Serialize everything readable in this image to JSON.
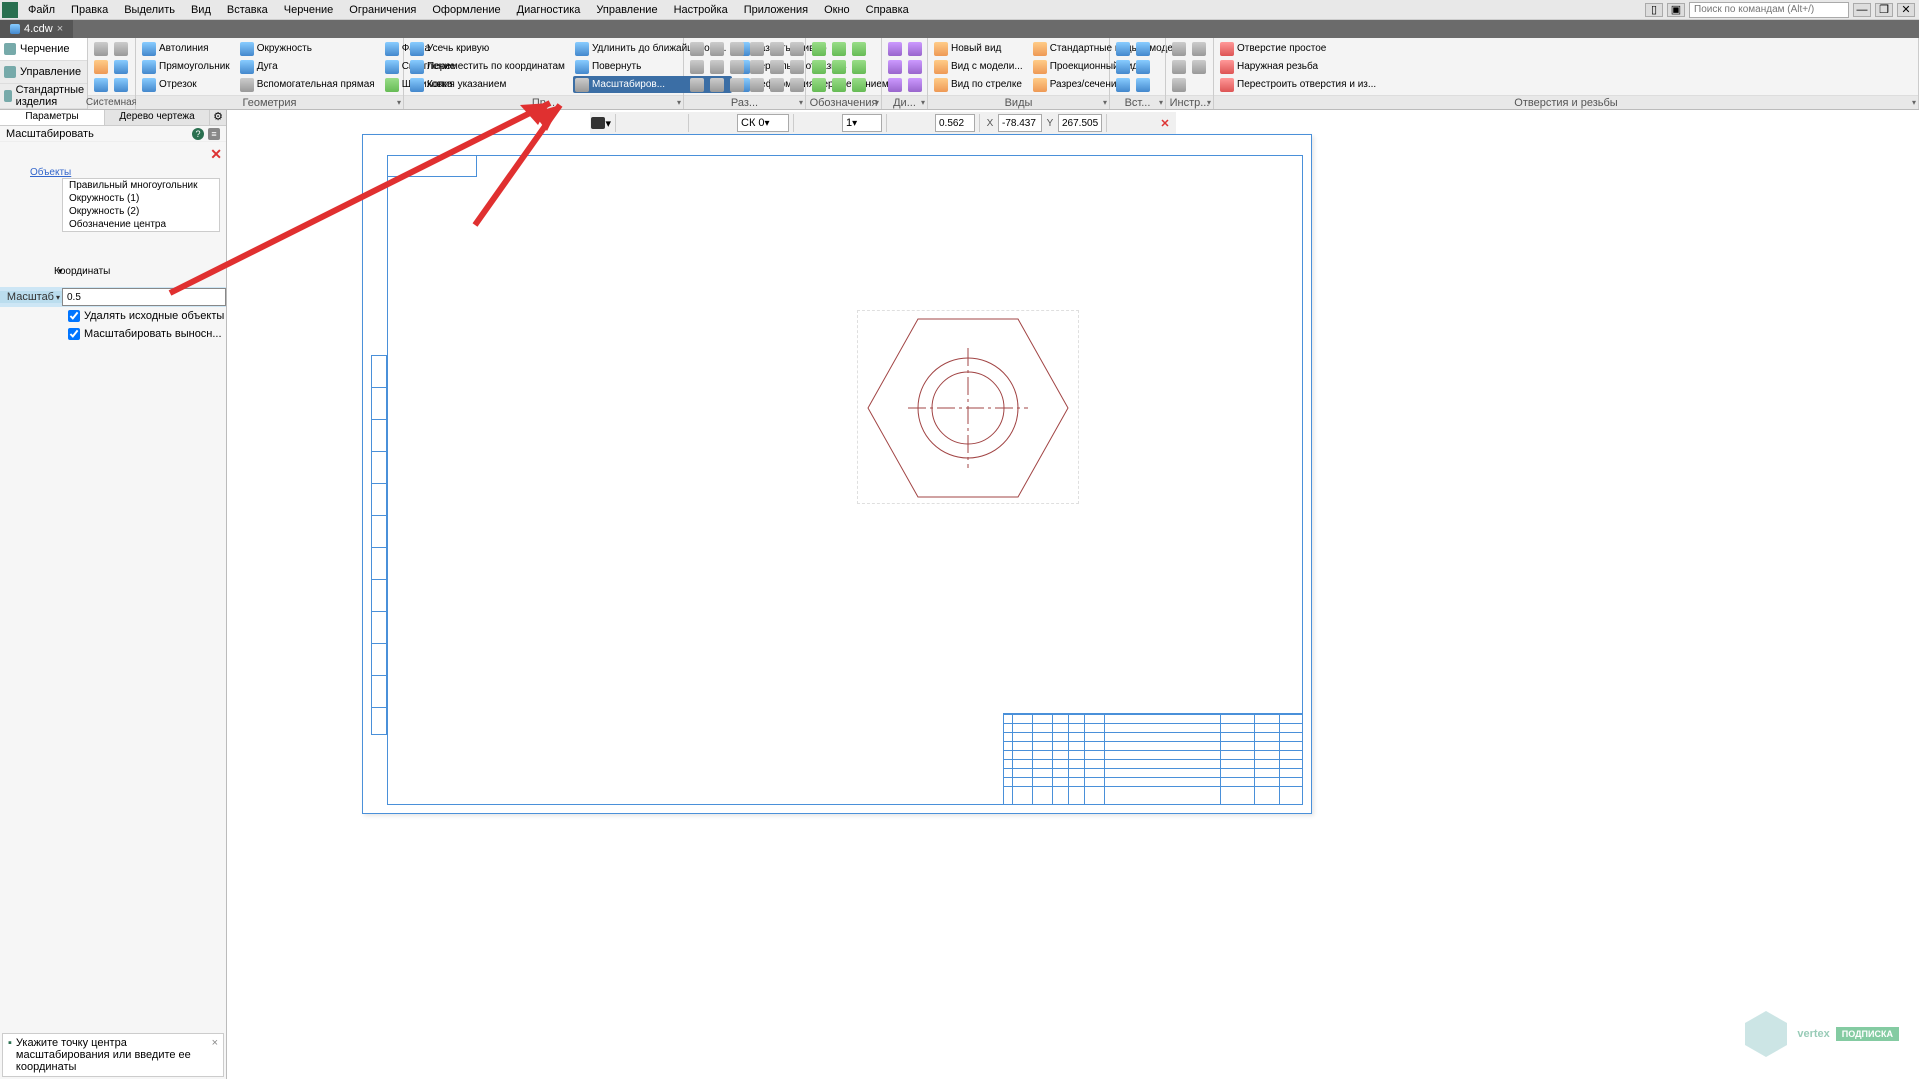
{
  "menu": {
    "items": [
      "Файл",
      "Правка",
      "Выделить",
      "Вид",
      "Вставка",
      "Черчение",
      "Ограничения",
      "Оформление",
      "Диагностика",
      "Управление",
      "Настройка",
      "Приложения",
      "Окно",
      "Справка"
    ],
    "search_placeholder": "Поиск по командам (Alt+/)"
  },
  "tabs": {
    "file": "4.cdw"
  },
  "modes": {
    "drawing": "Черчение",
    "manage": "Управление",
    "standard": "Стандартные изделия"
  },
  "ribbon": {
    "group_system": "Системная",
    "group_geometry": "Геометрия",
    "group_edit": "Пр...",
    "group_mark": "Раз...",
    "group_desig": "Обозначения",
    "group_constraints": "Ди...",
    "group_views": "Виды",
    "group_insert": "Вст...",
    "group_tools": "Инстр...",
    "group_holes": "Отверстия и резьбы",
    "autoline": "Автолиния",
    "circle": "Окружность",
    "rectangle": "Прямоугольник",
    "arc": "Дуга",
    "segment": "Отрезок",
    "auxline": "Вспомогательная прямая",
    "chamfer": "Фаска",
    "fillet": "Скругление",
    "hatch": "Штриховка",
    "trim": "Усечь кривую",
    "movecoord": "Переместить по координатам",
    "copyref": "Копия указанием",
    "extend": "Удлинить до ближайшего о...",
    "rotate": "Повернуть",
    "scale": "Масштабиров...",
    "split": "Разбить кривую",
    "mirror": "Зеркально отразить",
    "deform": "Деформация перемещением",
    "newview": "Новый вид",
    "modelview": "Вид с модели...",
    "arrowview": "Вид по стрелке",
    "stdviews": "Стандартные виды с модел...",
    "projview": "Проекционный вид",
    "section": "Разрез/сечение",
    "hole_simple": "Отверстие простое",
    "hole_thread": "Наружная резьба",
    "hole_rebuild": "Перестроить отверстия и из..."
  },
  "leftpanel": {
    "tab_params": "Параметры",
    "tab_tree": "Дерево чертежа",
    "operation": "Масштабировать",
    "objects_label": "Объекты",
    "objects": [
      "Правильный многоугольник",
      "Окружность (1)",
      "Окружность (2)",
      "Обозначение центра"
    ],
    "coords_section": "Координаты",
    "scale_label": "Масштаб",
    "scale_value": "0.5",
    "chk_delete": "Удалять исходные объекты",
    "chk_scale_ext": "Масштабировать выносн..."
  },
  "ctx": {
    "cs": "СК 0",
    "step": "1",
    "zoom": "0.562",
    "x_label": "X",
    "x": "-78.437",
    "y_label": "Y",
    "y": "267.505"
  },
  "status": {
    "prompt": "Укажите точку центра масштабирования или введите ее координаты"
  },
  "watermark": {
    "text": "vertex",
    "badge": "ПОДПИСКА"
  }
}
